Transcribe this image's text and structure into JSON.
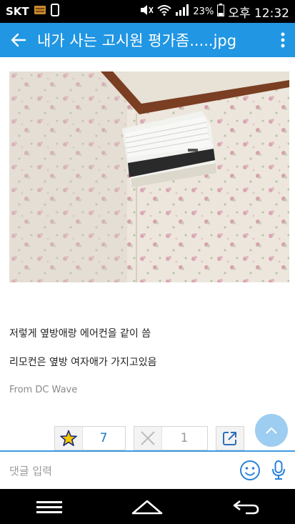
{
  "status_bar": {
    "carrier": "SKT",
    "battery": "23%",
    "clock": "오후 12:32"
  },
  "app_bar": {
    "title": "내가 사는 고시원 평가좀.....jpg"
  },
  "post": {
    "line1": "저렇게 옆방애랑 에어컨을 같이 씀",
    "line2": "리모컨은 옆방 여자애가 가지고있음",
    "source": "From DC Wave"
  },
  "reactions": {
    "like_count": "7",
    "dislike_count": "1"
  },
  "comment": {
    "placeholder": "댓글 입력"
  },
  "colors": {
    "app_bar": "#2196e3",
    "accent": "#1e76c8"
  }
}
